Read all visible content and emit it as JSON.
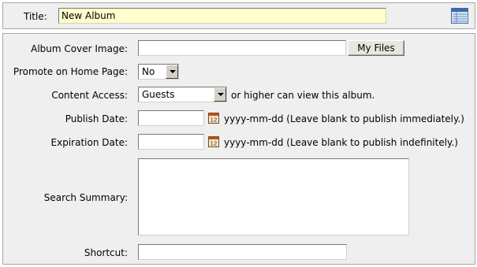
{
  "title_row": {
    "label": "Title:",
    "value": "New Album"
  },
  "form": {
    "album_cover": {
      "label": "Album Cover Image:",
      "value": "",
      "button": "My Files"
    },
    "promote": {
      "label": "Promote on Home Page:",
      "value": "No"
    },
    "content_access": {
      "label": "Content Access:",
      "value": "Guests",
      "suffix": "or higher can view this album."
    },
    "publish_date": {
      "label": "Publish Date:",
      "value": "",
      "hint": "yyyy-mm-dd (Leave blank to publish immediately.)"
    },
    "expiration_date": {
      "label": "Expiration Date:",
      "value": "",
      "hint": "yyyy-mm-dd (Leave blank to publish indefinitely.)"
    },
    "search_summary": {
      "label": "Search Summary:",
      "value": ""
    },
    "shortcut": {
      "label": "Shortcut:",
      "value": ""
    }
  },
  "icons": {
    "layout": "table-layout-icon",
    "calendar": "calendar-icon"
  },
  "colors": {
    "title_input_bg": "#ffffcc",
    "panel_bg": "#efefef",
    "panel_border": "#a7a6aa"
  }
}
